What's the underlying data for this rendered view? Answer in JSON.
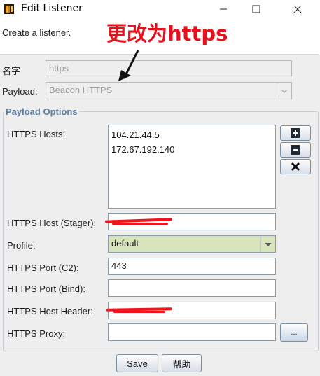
{
  "window": {
    "title": "Edit Listener",
    "minimize_glyph": "—",
    "maximize_glyph": "☐",
    "close_glyph": "✕"
  },
  "description": "Create a listener.",
  "annotation": {
    "text": "更改为https",
    "color": "#e8101a"
  },
  "form": {
    "name_label": "名字",
    "name_value": "https",
    "payload_label": "Payload:",
    "payload_value": "Beacon HTTPS",
    "options_title": "Payload Options",
    "https_hosts_label": "HTTPS Hosts:",
    "https_hosts": [
      "104.21.44.5",
      "172.67.192.140"
    ],
    "host_stager_label": "HTTPS Host (Stager):",
    "host_stager_value": "",
    "profile_label": "Profile:",
    "profile_value": "default",
    "port_c2_label": "HTTPS Port (C2):",
    "port_c2_value": "443",
    "port_bind_label": "HTTPS Port (Bind):",
    "port_bind_value": "",
    "host_header_label": "HTTPS Host Header:",
    "host_header_value": "",
    "proxy_label": "HTTPS Proxy:",
    "proxy_value": "",
    "proxy_button": "..."
  },
  "tool_buttons": {
    "add_icon": "plus-icon",
    "remove_icon": "minus-icon",
    "clear_icon": "x-icon"
  },
  "buttons": {
    "save": "Save",
    "help": "帮助"
  },
  "colors": {
    "accent_title": "#5b7ea3",
    "profile_bg": "#d8e4bc",
    "redaction": "#f0141c"
  }
}
